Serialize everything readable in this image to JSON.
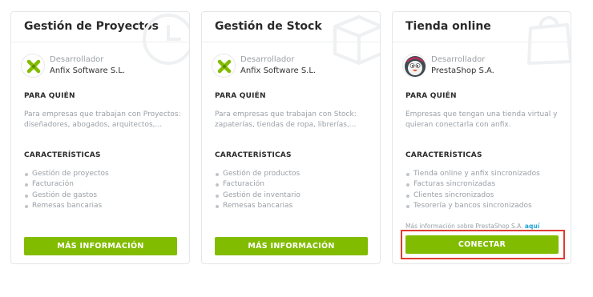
{
  "cards": [
    {
      "title": "Gestión de Proyectos",
      "bg_icon": "clock-icon",
      "vendor_role": "Desarrollador",
      "vendor_name": "Anfix Software S.L.",
      "vendor_logo": "anfix-logo",
      "audience_label": "PARA QUIÉN",
      "audience_text": "Para empresas que trabajan con Proyectos: diseñadores, abogados, arquitectos,...",
      "features_label": "CARACTERÍSTICAS",
      "features": [
        "Gestión de proyectos",
        "Facturación",
        "Gestión de gastos",
        "Remesas bancarias"
      ],
      "button_label": "MÁS INFORMACIÓN"
    },
    {
      "title": "Gestión de Stock",
      "bg_icon": "box-icon",
      "vendor_role": "Desarrollador",
      "vendor_name": "Anfix Software S.L.",
      "vendor_logo": "anfix-logo",
      "audience_label": "PARA QUIÉN",
      "audience_text": "Para empresas que trabajan con Stock: zapaterías, tiendas de ropa, librerías,...",
      "features_label": "CARACTERÍSTICAS",
      "features": [
        "Gestión de productos",
        "Facturación",
        "Gestión de inventario",
        "Remesas bancarias"
      ],
      "button_label": "MÁS INFORMACIÓN"
    },
    {
      "title": "Tienda online",
      "bg_icon": "shopping-bag-icon",
      "vendor_role": "Desarrollador",
      "vendor_name": "PrestaShop S.A.",
      "vendor_logo": "prestashop-logo",
      "audience_label": "PARA QUIÉN",
      "audience_text": "Empresas que tengan una tienda virtual y quieran conectarla con anfix.",
      "features_label": "CARACTERÍSTICAS",
      "features": [
        "Tienda online y anfix sincronizados",
        "Facturas sincronizadas",
        "Clientes sincronizados",
        "Tesorería y bancos sincronizados"
      ],
      "more_info_text": "Más información sobre PrestaShop S.A.",
      "more_info_link": "aquí",
      "button_label": "CONECTAR"
    }
  ],
  "colors": {
    "button": "#82bc00",
    "highlight": "#e03c31",
    "link": "#1fa2d6"
  }
}
